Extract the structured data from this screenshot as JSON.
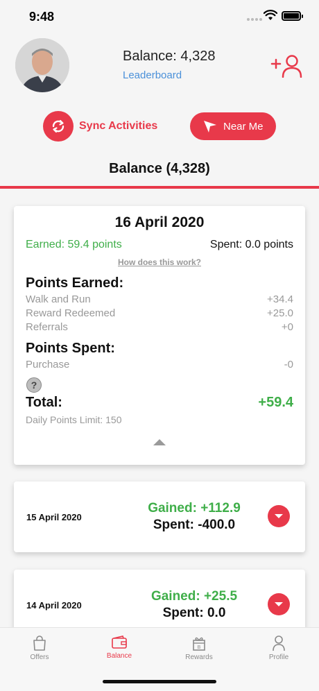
{
  "status_bar": {
    "time": "9:48"
  },
  "header": {
    "balance_title": "Balance: 4,328",
    "leaderboard_link": "Leaderboard"
  },
  "actions": {
    "sync_label": "Sync Activities",
    "near_me_label": "Near Me"
  },
  "page_heading": "Balance (4,328)",
  "today": {
    "date": "16 April 2020",
    "earned": "Earned: 59.4 points",
    "spent": "Spent: 0.0 points",
    "how_link": "How does this work?",
    "points_earned_heading": "Points Earned:",
    "earned_items": [
      {
        "label": "Walk and Run",
        "value": "+34.4"
      },
      {
        "label": "Reward Redeemed",
        "value": "+25.0"
      },
      {
        "label": "Referrals",
        "value": "+0"
      }
    ],
    "points_spent_heading": "Points Spent:",
    "spent_items": [
      {
        "label": "Purchase",
        "value": "-0"
      }
    ],
    "help_mark": "?",
    "total_label": "Total:",
    "total_value": "+59.4",
    "daily_limit": "Daily Points Limit: 150"
  },
  "history": [
    {
      "date": "15 April 2020",
      "gained": "Gained: +112.9",
      "spent": "Spent: -400.0"
    },
    {
      "date": "14 April 2020",
      "gained": "Gained: +25.5",
      "spent": "Spent: 0.0"
    }
  ],
  "tabs": [
    {
      "label": "Offers",
      "icon": "shopping-bag-icon",
      "active": false
    },
    {
      "label": "Balance",
      "icon": "wallet-icon",
      "active": true
    },
    {
      "label": "Rewards",
      "icon": "gift-icon",
      "active": false
    },
    {
      "label": "Profile",
      "icon": "person-icon",
      "active": false
    }
  ],
  "colors": {
    "accent": "#e8394a",
    "positive": "#3fae49",
    "link": "#4a90d9"
  }
}
